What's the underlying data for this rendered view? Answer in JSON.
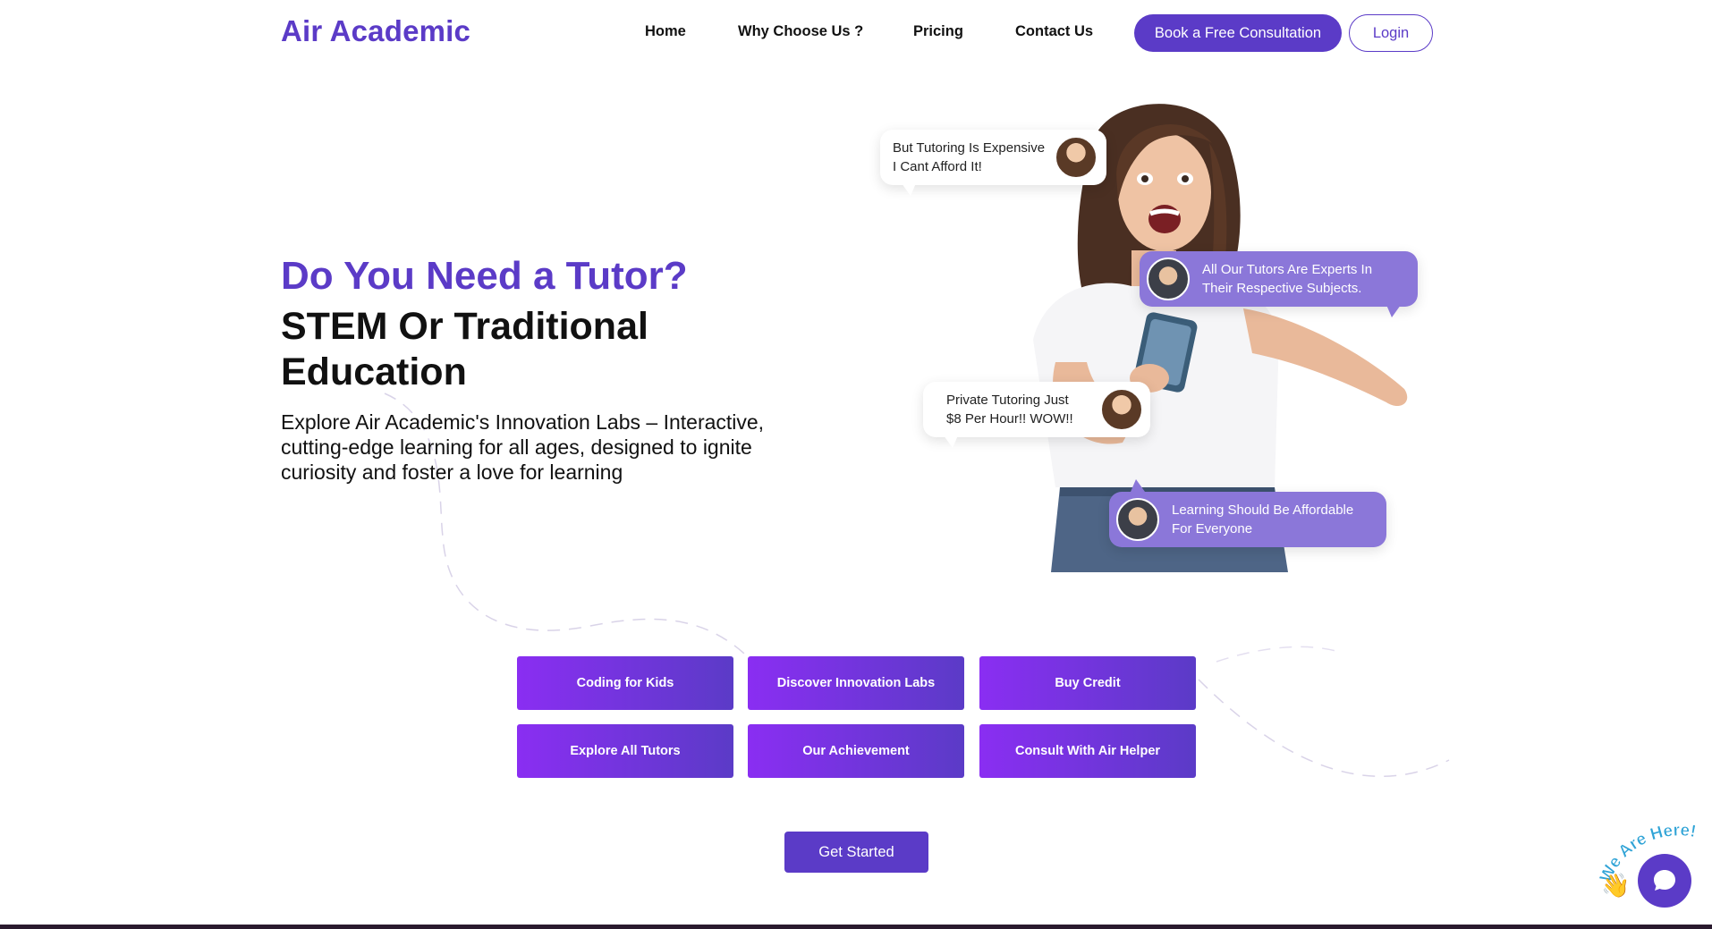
{
  "nav": {
    "brand": "Air Academic",
    "links": [
      "Home",
      "Why Choose Us ?",
      "Pricing",
      "Contact Us"
    ],
    "consult_label": "Book a Free Consultation",
    "login_label": "Login"
  },
  "hero": {
    "question": "Do You Need a Tutor?",
    "heading": "STEM Or Traditional Education",
    "description": "Explore Air Academic's Innovation Labs – Interactive, cutting-edge learning for all ages, designed to ignite curiosity and foster a love for learning",
    "bubbles": [
      "But Tutoring Is Expensive\nI Cant Afford It!",
      "All Our Tutors Are Experts In\nTheir Respective Subjects.",
      "Private Tutoring  Just\n$8 Per Hour!! WOW!!",
      "Learning Should Be Affordable\nFor Everyone"
    ]
  },
  "actions": [
    "Coding for Kids",
    "Discover Innovation Labs",
    "Buy Credit",
    "Explore All Tutors",
    "Our Achievement",
    "Consult With Air Helper"
  ],
  "get_started_label": "Get Started",
  "chat": {
    "badge_text": "We Are Here!"
  },
  "colors": {
    "brand": "#5b3bc7",
    "gradient_start": "#8a2ef2",
    "bubble_purple": "#8b77d9"
  },
  "icons": {
    "chat": "chat-bubble-icon",
    "wave": "waving-hand-icon"
  }
}
